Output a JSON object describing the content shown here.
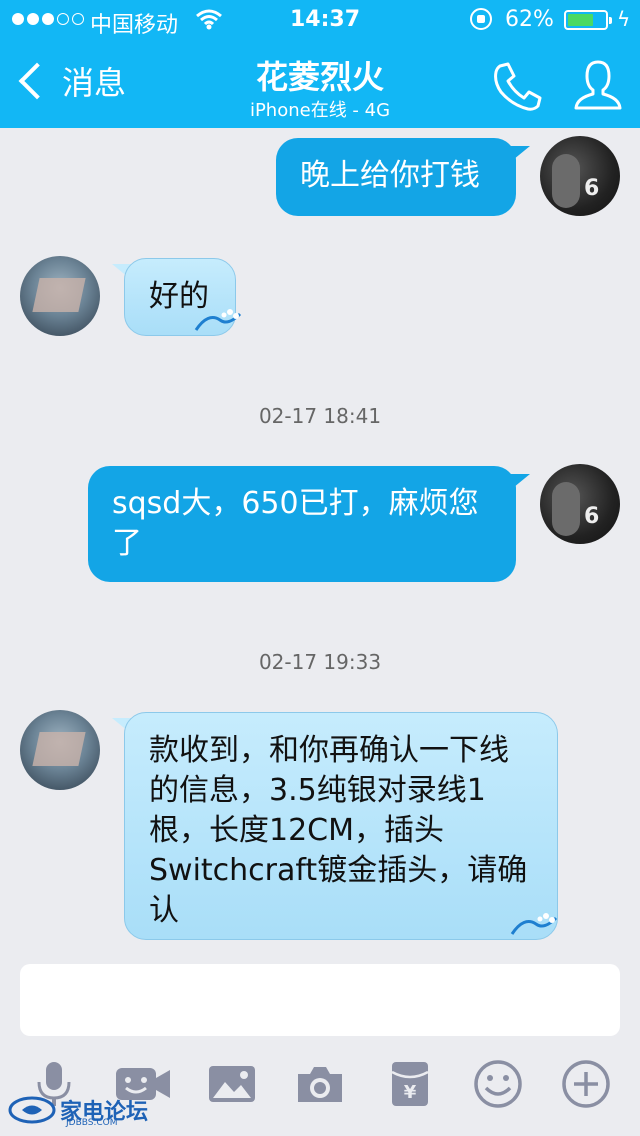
{
  "status_bar": {
    "carrier": "中国移动",
    "time": "14:37",
    "battery_percent": "62%",
    "battery_level": 0.62,
    "signal_bars": 3
  },
  "nav": {
    "back_label": "消息",
    "title": "花菱烈火",
    "subtitle": "iPhone在线 - 4G"
  },
  "messages": [
    {
      "side": "out",
      "text": "晚上给你打钱"
    },
    {
      "side": "in",
      "text": "好的"
    },
    {
      "timestamp": "02-17 18:41"
    },
    {
      "side": "out",
      "text": "sqsd大，650已打，麻烦您了"
    },
    {
      "timestamp": "02-17 19:33"
    },
    {
      "side": "in",
      "text": "款收到，和你再确认一下线的信息，3.5纯银对录线1根，长度12CM，插头Switchcraft镀金插头，请确认"
    }
  ],
  "input": {
    "value": ""
  },
  "toolbar": {
    "icons": [
      "microphone-icon",
      "video-icon",
      "image-icon",
      "camera-icon",
      "red-packet-icon",
      "emoji-icon",
      "plus-icon"
    ]
  },
  "watermark": {
    "text": "家电论坛",
    "sub": "JDBBS.COM"
  },
  "colors": {
    "header": "#12b7f5",
    "outgoing_bubble": "#13a5e6",
    "incoming_bubble": "#c6ecfd",
    "background": "#ebecf0",
    "battery": "#4cd964"
  }
}
